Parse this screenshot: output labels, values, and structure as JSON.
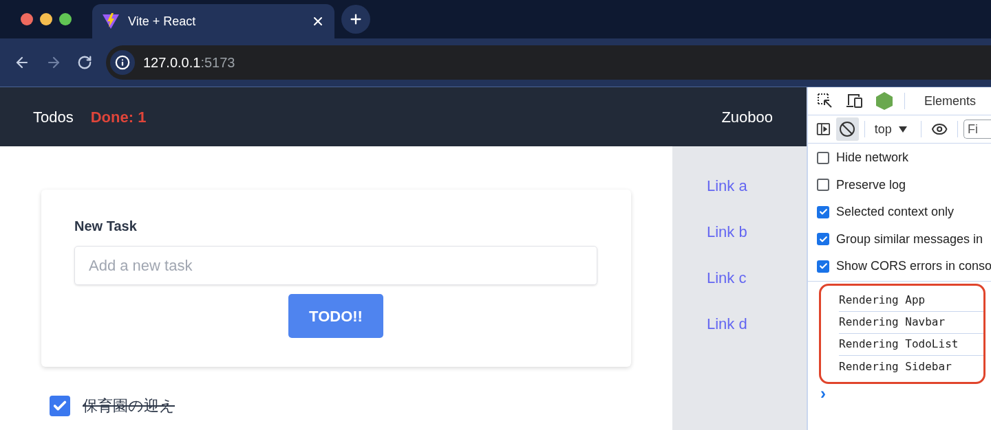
{
  "browser": {
    "tab_title": "Vite + React",
    "address_host": "127.0.0.1",
    "address_port": ":5173"
  },
  "navbar": {
    "title": "Todos",
    "done": "Done: 1",
    "user": "Zuoboo"
  },
  "form": {
    "label": "New Task",
    "placeholder": "Add a new task",
    "button": "TODO!!"
  },
  "todos": [
    {
      "text": "保育園の迎え",
      "checked": true
    }
  ],
  "sidebar": {
    "links": [
      "Link a",
      "Link b",
      "Link c",
      "Link d"
    ]
  },
  "devtools": {
    "tab": "Elements",
    "context": "top",
    "filter_placeholder": "Fi",
    "settings": [
      {
        "label": "Hide network",
        "checked": false
      },
      {
        "label": "Preserve log",
        "checked": false
      },
      {
        "label": "Selected context only",
        "checked": true
      },
      {
        "label": "Group similar messages in",
        "checked": true
      },
      {
        "label": "Show CORS errors in conso",
        "checked": true
      }
    ],
    "messages": [
      "Rendering App",
      "Rendering Navbar",
      "Rendering TodoList",
      "Rendering Sidebar"
    ],
    "prompt": "›"
  }
}
